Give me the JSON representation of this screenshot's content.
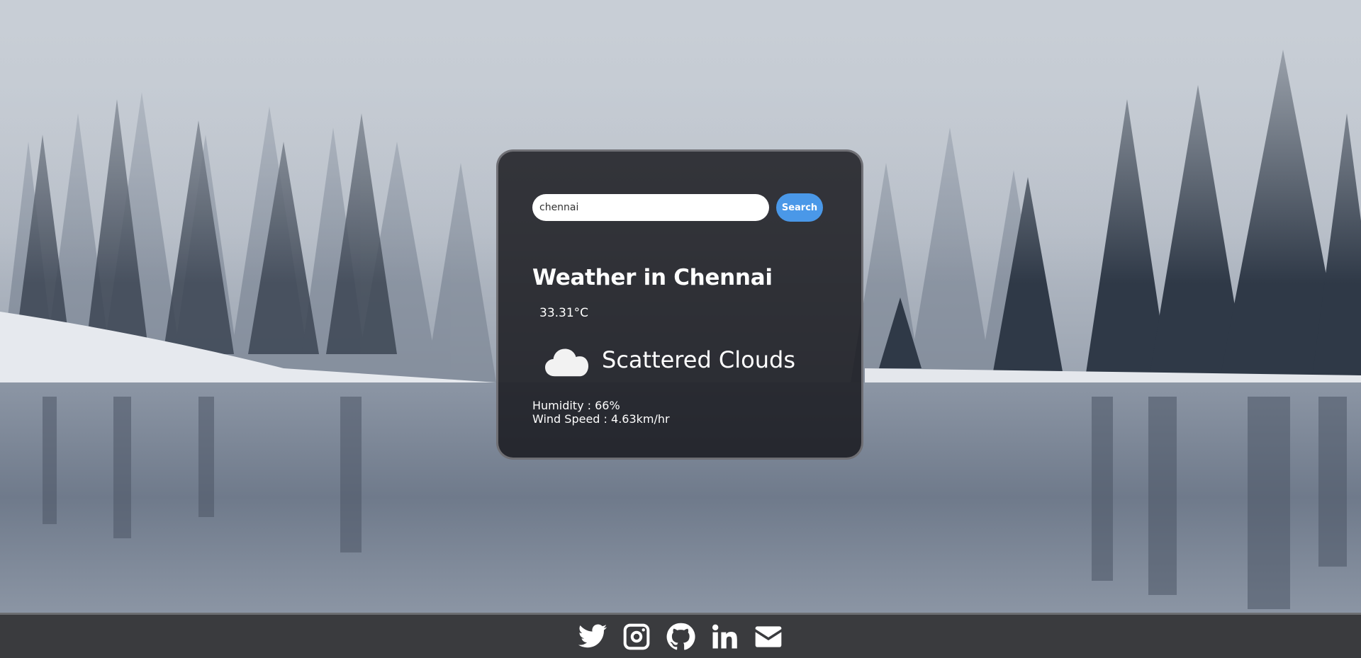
{
  "search": {
    "value": "chennai",
    "button_label": "Search"
  },
  "weather": {
    "title": "Weather in Chennai",
    "temperature": "33.31°C",
    "condition": "Scattered Clouds",
    "condition_icon": "cloud-icon",
    "humidity": "Humidity : 66%",
    "wind": "Wind Speed : 4.63km/hr"
  },
  "footer": {
    "links": [
      {
        "icon": "twitter-icon"
      },
      {
        "icon": "instagram-icon"
      },
      {
        "icon": "github-icon"
      },
      {
        "icon": "linkedin-icon"
      },
      {
        "icon": "mail-icon"
      }
    ]
  },
  "colors": {
    "card_bg": "#1a1a1e",
    "accent": "#4a98e8",
    "footer_bg": "#3a3b3e",
    "text": "#ffffff"
  }
}
